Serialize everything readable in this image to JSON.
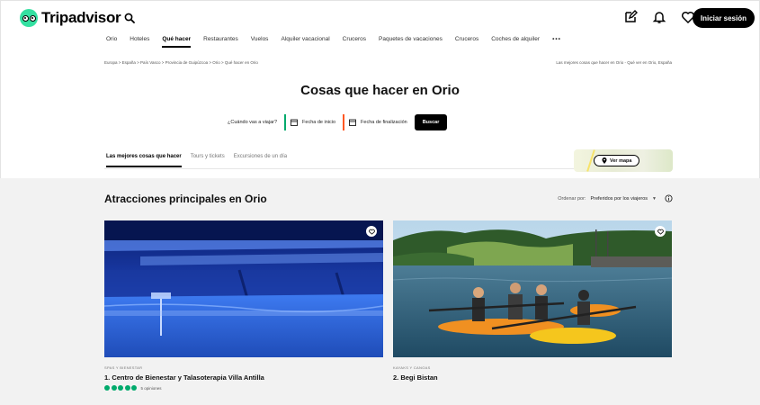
{
  "header": {
    "brand": "Tripadvisor",
    "login_label": "Iniciar sesión",
    "icons": [
      "search-icon",
      "edit-icon",
      "bell-icon",
      "heart-icon"
    ]
  },
  "nav": {
    "items": [
      {
        "label": "Orio",
        "active": false
      },
      {
        "label": "Hoteles",
        "active": false
      },
      {
        "label": "Qué hacer",
        "active": true
      },
      {
        "label": "Restaurantes",
        "active": false
      },
      {
        "label": "Vuelos",
        "active": false
      },
      {
        "label": "Alquiler vacacional",
        "active": false
      },
      {
        "label": "Cruceros",
        "active": false
      },
      {
        "label": "Paquetes de vacaciones",
        "active": false
      },
      {
        "label": "Cruceros",
        "active": false
      },
      {
        "label": "Coches de alquiler",
        "active": false
      }
    ],
    "more_label": "•••"
  },
  "breadcrumb": {
    "path": "Europa > España > País Vasco > Provincia de Guipúzcoa > Orio > Qué hacer en Orio",
    "right_text": "Las mejores cosas que hacer en Orio - Qué ver en Orio, España"
  },
  "page_title": "Cosas que hacer en Orio",
  "date_search": {
    "question": "¿Cuándo vas a viajar?",
    "start_placeholder": "Fecha de inicio",
    "end_placeholder": "Fecha de finalización",
    "search_label": "Buscar",
    "colors": {
      "start": "#00aa6c",
      "end": "#ff5722"
    }
  },
  "tabs": [
    {
      "label": "Las mejores cosas que hacer",
      "active": true
    },
    {
      "label": "Tours y tickets",
      "active": false
    },
    {
      "label": "Excursiones de un día",
      "active": false
    }
  ],
  "map": {
    "button_label": "Ver mapa"
  },
  "attractions": {
    "title": "Atracciones principales en Orio",
    "sort_label": "Ordenar por:",
    "sort_value": "Preferidos por los viajeros",
    "cards": [
      {
        "category": "SPAS Y BIENESTAR",
        "name": "1. Centro de Bienestar y Talasoterapia Villa Antilla",
        "rating_bubbles": 5,
        "reviews": "5 opiniones"
      },
      {
        "category": "KAYAKS Y CANOAS",
        "name": "2. Begi Bistan"
      }
    ]
  },
  "colors": {
    "brand_green": "#34e0a1",
    "rating_green": "#00aa6c",
    "primary_black": "#000000"
  }
}
